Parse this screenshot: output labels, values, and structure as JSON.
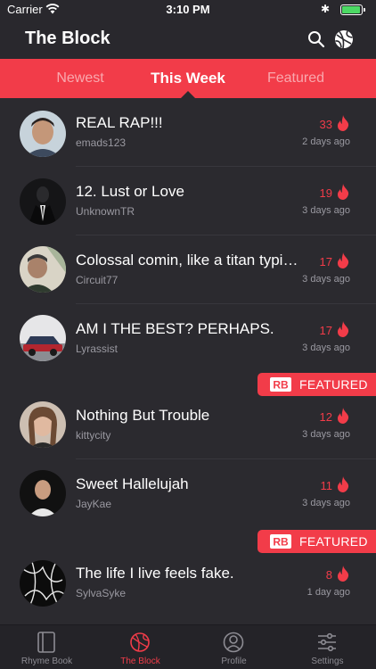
{
  "status": {
    "carrier": "Carrier",
    "time": "3:10 PM",
    "battery_level": 0.95
  },
  "app": {
    "title": "The Block"
  },
  "tabs": [
    {
      "label": "Newest",
      "active": false
    },
    {
      "label": "This Week",
      "active": true
    },
    {
      "label": "Featured",
      "active": false
    }
  ],
  "feed": [
    {
      "title": "REAL RAP!!!",
      "user": "emads123",
      "count": "33",
      "time": "2 days ago"
    },
    {
      "title": "12. Lust or Love",
      "user": "UnknownTR",
      "count": "19",
      "time": "3 days ago"
    },
    {
      "title": "Colossal comin, like a titan typing",
      "user": "Circuit77",
      "count": "17",
      "time": "3 days ago"
    },
    {
      "title": "AM I THE BEST? PERHAPS.",
      "user": "Lyrassist",
      "count": "17",
      "time": "3 days ago"
    },
    {
      "title": "Nothing But Trouble",
      "user": "kittycity",
      "count": "12",
      "time": "3 days ago",
      "featured": true
    },
    {
      "title": "Sweet Hallelujah",
      "user": "JayKae",
      "count": "11",
      "time": "3 days ago"
    },
    {
      "title": "The life I live feels fake.",
      "user": "SylvaSyke",
      "count": "8",
      "time": "1 day ago",
      "featured": true
    }
  ],
  "featured_label": "FEATURED",
  "featured_logo_text": "RB",
  "tabbar": [
    {
      "label": "Rhyme Book",
      "icon": "book-icon",
      "active": false
    },
    {
      "label": "The Block",
      "icon": "block-icon",
      "active": true
    },
    {
      "label": "Profile",
      "icon": "profile-icon",
      "active": false
    },
    {
      "label": "Settings",
      "icon": "settings-icon",
      "active": false
    }
  ],
  "colors": {
    "accent": "#f23c49",
    "background": "#2b2a2f",
    "tabbar": "#242328"
  }
}
